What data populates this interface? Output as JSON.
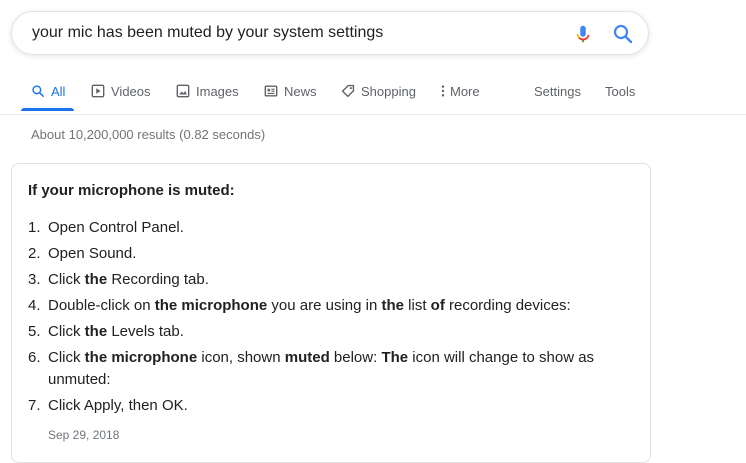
{
  "search": {
    "query": "your mic has been muted by your system settings"
  },
  "tabs": [
    {
      "label": "All",
      "icon": "search-icon",
      "active": true
    },
    {
      "label": "Videos",
      "icon": "video-icon"
    },
    {
      "label": "Images",
      "icon": "image-icon"
    },
    {
      "label": "News",
      "icon": "news-icon"
    },
    {
      "label": "Shopping",
      "icon": "tag-icon"
    },
    {
      "label": "More",
      "icon": "more-vert-icon"
    }
  ],
  "tools": {
    "settings": "Settings",
    "tools": "Tools"
  },
  "result_stats": "About 10,200,000 results (0.82 seconds)",
  "snippet": {
    "title": "If your microphone is muted:",
    "date": "Sep 29, 2018",
    "steps": [
      {
        "num": "1.",
        "parts": [
          {
            "t": "Open Control Panel.",
            "b": false
          }
        ]
      },
      {
        "num": "2.",
        "parts": [
          {
            "t": "Open Sound.",
            "b": false
          }
        ]
      },
      {
        "num": "3.",
        "parts": [
          {
            "t": "Click ",
            "b": false
          },
          {
            "t": "the",
            "b": true
          },
          {
            "t": " Recording tab.",
            "b": false
          }
        ]
      },
      {
        "num": "4.",
        "parts": [
          {
            "t": "Double-click on ",
            "b": false
          },
          {
            "t": "the microphone",
            "b": true
          },
          {
            "t": " you are using in ",
            "b": false
          },
          {
            "t": "the",
            "b": true
          },
          {
            "t": " list ",
            "b": false
          },
          {
            "t": "of",
            "b": true
          },
          {
            "t": " recording devices:",
            "b": false
          }
        ]
      },
      {
        "num": "5.",
        "parts": [
          {
            "t": "Click ",
            "b": false
          },
          {
            "t": "the",
            "b": true
          },
          {
            "t": " Levels tab.",
            "b": false
          }
        ]
      },
      {
        "num": "6.",
        "parts": [
          {
            "t": "Click ",
            "b": false
          },
          {
            "t": "the microphone",
            "b": true
          },
          {
            "t": " icon, shown ",
            "b": false
          },
          {
            "t": "muted",
            "b": true
          },
          {
            "t": " below: ",
            "b": false
          },
          {
            "t": "The",
            "b": true
          },
          {
            "t": " icon will change to show as unmuted:",
            "b": false
          }
        ]
      },
      {
        "num": "7.",
        "parts": [
          {
            "t": "Click Apply, then OK.",
            "b": false
          }
        ]
      }
    ]
  },
  "colors": {
    "accent": "#1a73e8",
    "muted_text": "#70757a",
    "tab_text": "#5f6368"
  }
}
